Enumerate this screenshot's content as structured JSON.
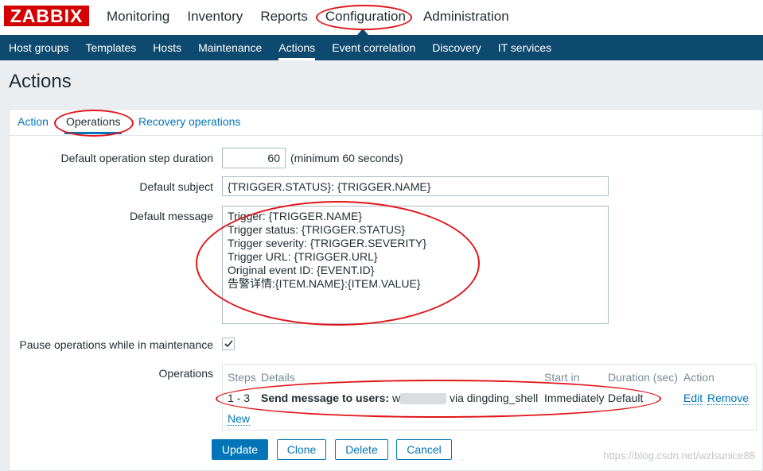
{
  "app": {
    "logo": "ZABBIX",
    "menu": [
      "Monitoring",
      "Inventory",
      "Reports",
      "Configuration",
      "Administration"
    ],
    "submenu": [
      "Host groups",
      "Templates",
      "Hosts",
      "Maintenance",
      "Actions",
      "Event correlation",
      "Discovery",
      "IT services"
    ]
  },
  "page": {
    "title": "Actions"
  },
  "tabs": {
    "action": "Action",
    "operations": "Operations",
    "recovery": "Recovery operations"
  },
  "form": {
    "step_duration_label": "Default operation step duration",
    "step_duration_value": "60",
    "step_duration_note": "(minimum 60 seconds)",
    "subject_label": "Default subject",
    "subject_value": "{TRIGGER.STATUS}: {TRIGGER.NAME}",
    "message_label": "Default message",
    "message_value": "Trigger: {TRIGGER.NAME}\nTrigger status: {TRIGGER.STATUS}\nTrigger severity: {TRIGGER.SEVERITY}\nTrigger URL: {TRIGGER.URL}\nOriginal event ID: {EVENT.ID}\n告警详情:{ITEM.NAME}:{ITEM.VALUE}",
    "pause_label": "Pause operations while in maintenance",
    "pause_checked": true,
    "operations_label": "Operations"
  },
  "operations_table": {
    "headers": {
      "steps": "Steps",
      "details": "Details",
      "start_in": "Start in",
      "duration": "Duration (sec)",
      "action": "Action"
    },
    "rows": [
      {
        "steps": "1 - 3",
        "details_bold": "Send message to users:",
        "details_prefix": "w",
        "details_suffix": "via dingding_shell",
        "start_in": "Immediately",
        "duration": "Default",
        "edit": "Edit",
        "remove": "Remove"
      }
    ],
    "new_link": "New"
  },
  "buttons": {
    "update": "Update",
    "clone": "Clone",
    "delete": "Delete",
    "cancel": "Cancel"
  },
  "watermark": "https://blog.csdn.net/wzlsunice88",
  "colors": {
    "brand_red": "#d40000",
    "subnav": "#0e4a6f",
    "link": "#0275b8",
    "annotation": "#e0161a"
  }
}
